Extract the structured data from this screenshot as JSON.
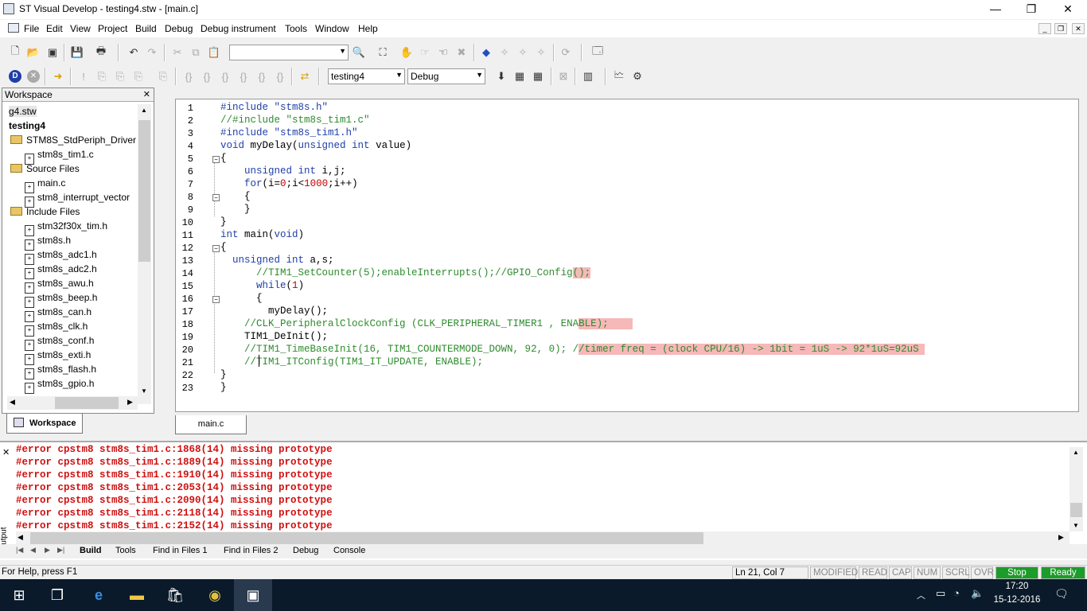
{
  "window": {
    "title": "ST Visual Develop - testing4.stw - [main.c]",
    "min": "—",
    "max": "❐",
    "close": "✕"
  },
  "menu": [
    "File",
    "Edit",
    "View",
    "Project",
    "Build",
    "Debug",
    "Debug instrument",
    "Tools",
    "Window",
    "Help"
  ],
  "toolbar": {
    "find_combo_value": "",
    "project_combo": "testing4",
    "config_combo": "Debug"
  },
  "workspace": {
    "title": "Workspace",
    "tab_label": "Workspace",
    "items": [
      {
        "label": "g4.stw",
        "type": "stw",
        "indent": 0
      },
      {
        "label": "testing4",
        "type": "project",
        "indent": 0
      },
      {
        "label": "STM8S_StdPeriph_Driver",
        "type": "folder",
        "indent": 1
      },
      {
        "label": "stm8s_tim1.c",
        "type": "file",
        "indent": 2
      },
      {
        "label": "Source Files",
        "type": "folder",
        "indent": 1
      },
      {
        "label": "main.c",
        "type": "file",
        "indent": 2
      },
      {
        "label": "stm8_interrupt_vector",
        "type": "file",
        "indent": 2
      },
      {
        "label": "Include Files",
        "type": "folder",
        "indent": 1
      },
      {
        "label": "stm32f30x_tim.h",
        "type": "file",
        "indent": 2
      },
      {
        "label": "stm8s.h",
        "type": "file",
        "indent": 2
      },
      {
        "label": "stm8s_adc1.h",
        "type": "file",
        "indent": 2
      },
      {
        "label": "stm8s_adc2.h",
        "type": "file",
        "indent": 2
      },
      {
        "label": "stm8s_awu.h",
        "type": "file",
        "indent": 2
      },
      {
        "label": "stm8s_beep.h",
        "type": "file",
        "indent": 2
      },
      {
        "label": "stm8s_can.h",
        "type": "file",
        "indent": 2
      },
      {
        "label": "stm8s_clk.h",
        "type": "file",
        "indent": 2
      },
      {
        "label": "stm8s_conf.h",
        "type": "file",
        "indent": 2
      },
      {
        "label": "stm8s_exti.h",
        "type": "file",
        "indent": 2
      },
      {
        "label": "stm8s_flash.h",
        "type": "file",
        "indent": 2
      },
      {
        "label": "stm8s_gpio.h",
        "type": "file",
        "indent": 2
      }
    ]
  },
  "editor": {
    "tab": "main.c",
    "line_numbers": [
      "1",
      "2",
      "3",
      "4",
      "5",
      "6",
      "7",
      "8",
      "9",
      "10",
      "11",
      "12",
      "13",
      "14",
      "15",
      "16",
      "17",
      "18",
      "19",
      "20",
      "21",
      "22",
      "23"
    ],
    "lines": [
      [
        {
          "t": "#include ",
          "c": "pp"
        },
        {
          "t": "\"stm8s.h\"",
          "c": "pp"
        }
      ],
      [
        {
          "t": "//#include \"stm8s_tim1.c\"",
          "c": "cm"
        }
      ],
      [
        {
          "t": "#include ",
          "c": "pp"
        },
        {
          "t": "\"stm8s_tim1.h\"",
          "c": "pp"
        }
      ],
      [
        {
          "t": "void ",
          "c": "kw"
        },
        {
          "t": "myDelay(",
          "c": ""
        },
        {
          "t": "unsigned int ",
          "c": "kw"
        },
        {
          "t": "value)",
          "c": ""
        }
      ],
      [
        {
          "t": "{",
          "c": ""
        }
      ],
      [
        {
          "t": "    ",
          "c": ""
        },
        {
          "t": "unsigned int ",
          "c": "kw"
        },
        {
          "t": "i,j;",
          "c": ""
        }
      ],
      [
        {
          "t": "    ",
          "c": ""
        },
        {
          "t": "for",
          "c": "kw"
        },
        {
          "t": "(i=",
          "c": ""
        },
        {
          "t": "0",
          "c": "nm"
        },
        {
          "t": ";i<",
          "c": ""
        },
        {
          "t": "1000",
          "c": "nm"
        },
        {
          "t": ";i++)",
          "c": ""
        }
      ],
      [
        {
          "t": "    {",
          "c": ""
        }
      ],
      [
        {
          "t": "    }",
          "c": ""
        }
      ],
      [
        {
          "t": "}",
          "c": ""
        }
      ],
      [
        {
          "t": "int ",
          "c": "kw"
        },
        {
          "t": "main(",
          "c": ""
        },
        {
          "t": "void",
          "c": "kw"
        },
        {
          "t": ")",
          "c": ""
        }
      ],
      [
        {
          "t": "{",
          "c": ""
        }
      ],
      [
        {
          "t": "  ",
          "c": ""
        },
        {
          "t": "unsigned int ",
          "c": "kw"
        },
        {
          "t": "a,s;",
          "c": ""
        }
      ],
      [
        {
          "t": "      //TIM1_SetCounter(5);enableInterrupts();//GPIO_Config",
          "c": "cm"
        },
        {
          "t": "();",
          "c": "cm hl"
        }
      ],
      [
        {
          "t": "      ",
          "c": ""
        },
        {
          "t": "while",
          "c": "kw"
        },
        {
          "t": "(",
          "c": ""
        },
        {
          "t": "1",
          "c": "nm"
        },
        {
          "t": ")",
          "c": ""
        }
      ],
      [
        {
          "t": "      {",
          "c": ""
        }
      ],
      [
        {
          "t": "        myDelay();",
          "c": ""
        }
      ],
      [
        {
          "t": "    //CLK_PeripheralClockConfig (CLK_PERIPHERAL_TIMER1 , ENA",
          "c": "cm"
        },
        {
          "t": "BLE);    ",
          "c": "cm hl"
        }
      ],
      [
        {
          "t": "    TIM1_DeInit();",
          "c": ""
        }
      ],
      [
        {
          "t": "    //TIM1_TimeBaseInit(16, TIM1_COUNTERMODE_DOWN, 92, 0); /",
          "c": "cm"
        },
        {
          "t": "/timer freq = (clock CPU/16) -> 1bit = 1uS -> 92*1uS=92uS ",
          "c": "cm hl"
        }
      ],
      [
        {
          "t": "    //TIM1_ITConfig(TIM1_IT_UPDATE, ENABLE);",
          "c": "cm"
        }
      ],
      [
        {
          "t": "}",
          "c": ""
        }
      ],
      [
        {
          "t": "}",
          "c": ""
        }
      ]
    ]
  },
  "output": {
    "side_label": "Output",
    "errors": [
      "#error cpstm8 stm8s_tim1.c:1868(14) missing prototype",
      "#error cpstm8 stm8s_tim1.c:1889(14) missing prototype",
      "#error cpstm8 stm8s_tim1.c:1910(14) missing prototype",
      "#error cpstm8 stm8s_tim1.c:2053(14) missing prototype",
      "#error cpstm8 stm8s_tim1.c:2090(14) missing prototype",
      "#error cpstm8 stm8s_tim1.c:2118(14) missing prototype",
      "#error cpstm8 stm8s_tim1.c:2152(14) missing prototype"
    ],
    "tabs": [
      "Build",
      "Tools",
      "Find in Files 1",
      "Find in Files 2",
      "Debug",
      "Console"
    ],
    "active_tab": "Build"
  },
  "status": {
    "help": "For Help, press F1",
    "position": "Ln 21, Col 7",
    "modified": "MODIFIED",
    "read": "READ",
    "cap": "CAP",
    "num": "NUM",
    "scrl": "SCRL",
    "ovr": "OVR",
    "stop": "Stop",
    "ready": "Ready",
    "green": "#1c9c2a"
  },
  "taskbar": {
    "time": "17:20",
    "date": "15-12-2016"
  }
}
